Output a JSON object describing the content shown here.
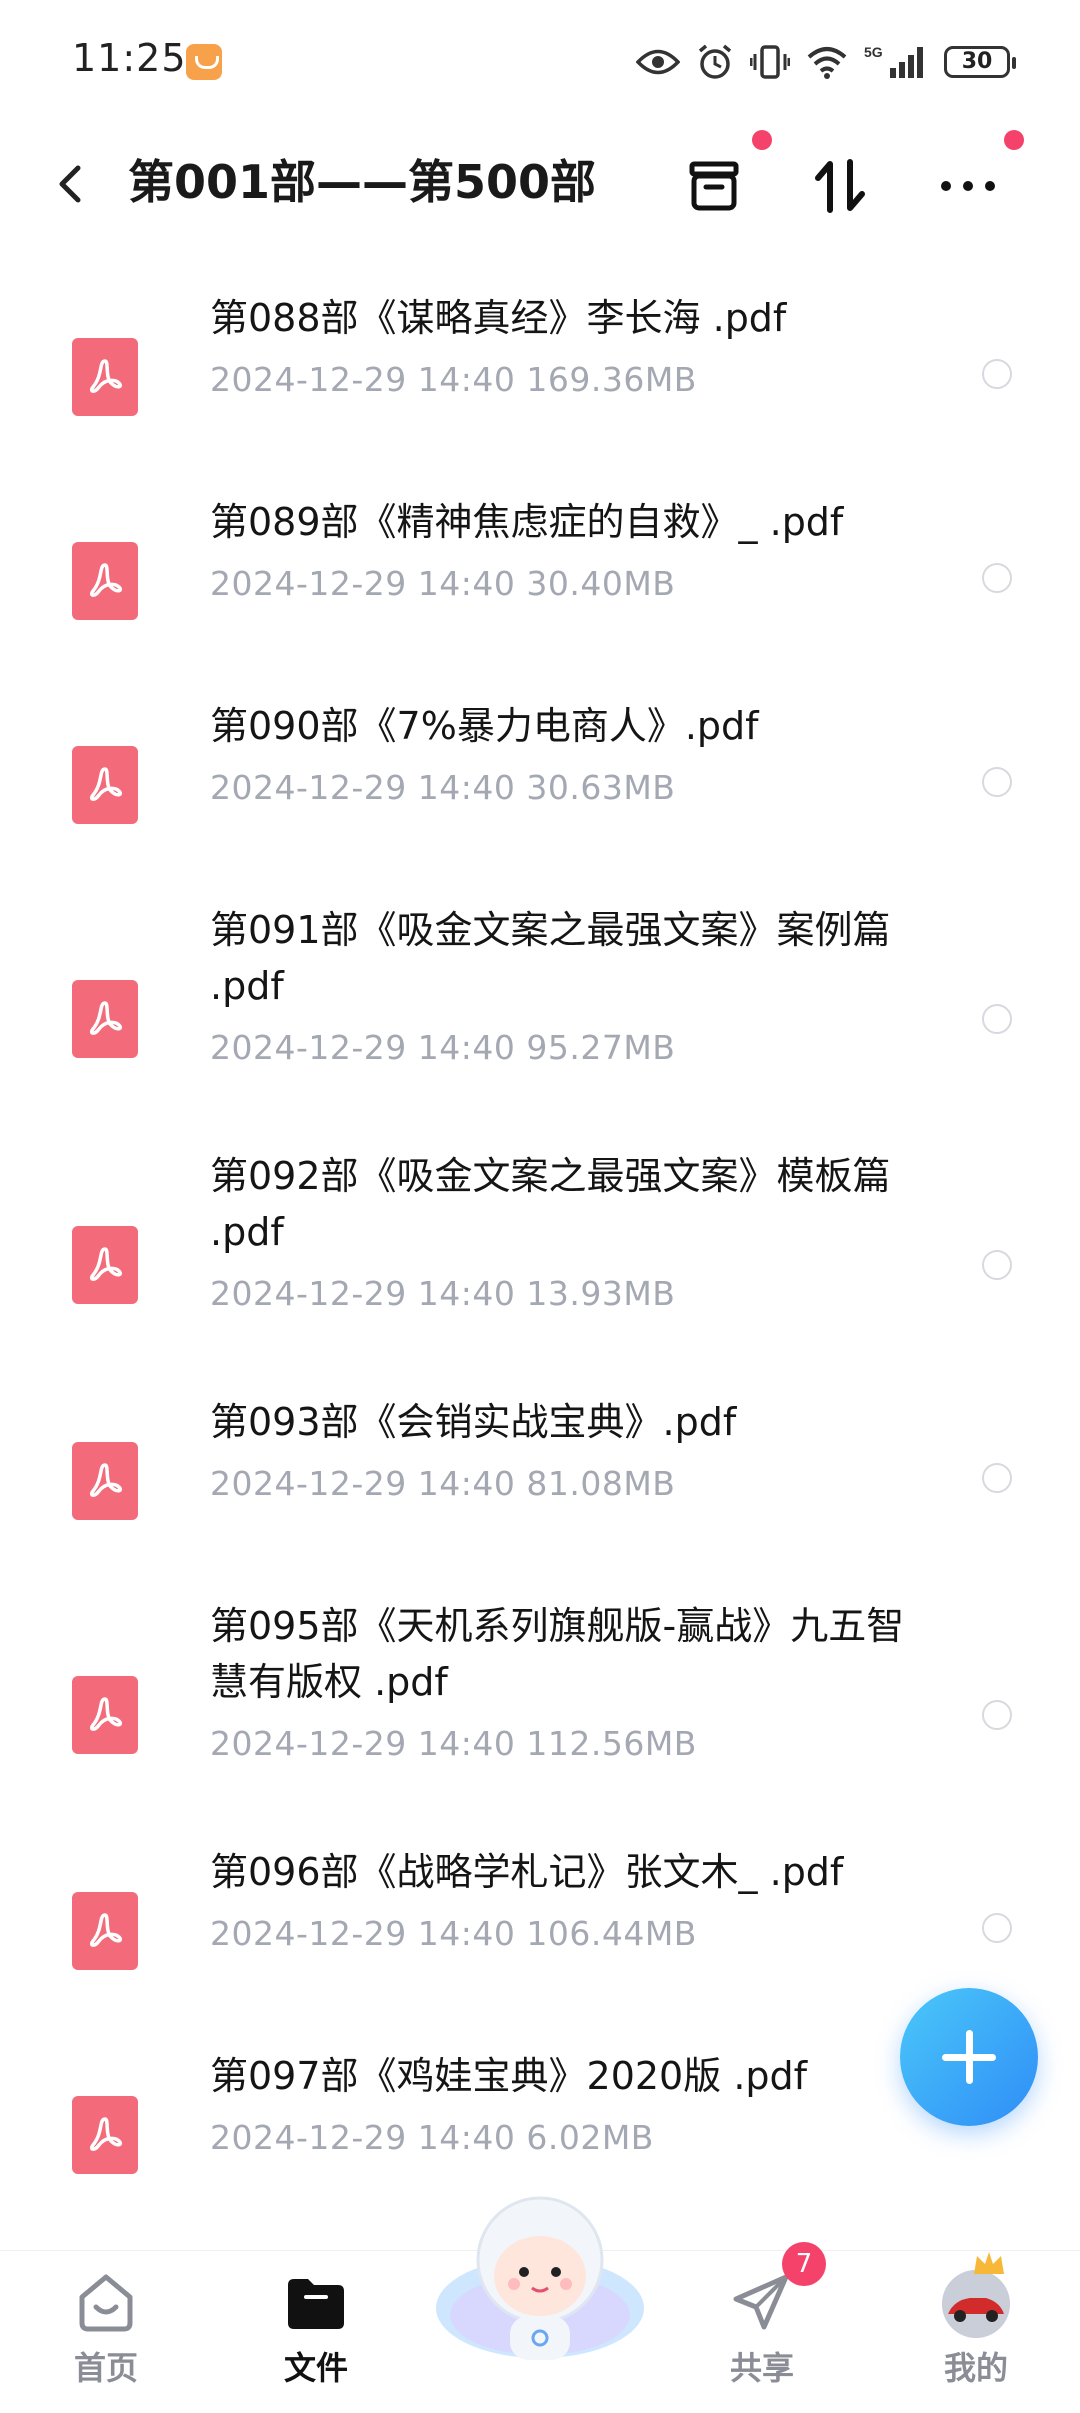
{
  "status_bar": {
    "time": "11:25",
    "battery": "30",
    "network": "5G"
  },
  "header": {
    "title": "第001部——第500部"
  },
  "files": [
    {
      "name": "第088部《谋略真经》李长海 .pdf",
      "meta": "2024-12-29  14:40  169.36MB"
    },
    {
      "name": "第089部《精神焦虑症的自救》_ .pdf",
      "meta": "2024-12-29  14:40  30.40MB"
    },
    {
      "name": "第090部《7%暴力电商人》.pdf",
      "meta": "2024-12-29  14:40  30.63MB"
    },
    {
      "name": "第091部《吸金文案之最强文案》案例篇 .pdf",
      "meta": "2024-12-29  14:40  95.27MB"
    },
    {
      "name": "第092部《吸金文案之最强文案》模板篇 .pdf",
      "meta": "2024-12-29  14:40  13.93MB"
    },
    {
      "name": "第093部《会销实战宝典》.pdf",
      "meta": "2024-12-29  14:40  81.08MB"
    },
    {
      "name": "第095部《天机系列旗舰版-赢战》九五智慧有版权 .pdf",
      "meta": "2024-12-29  14:40  112.56MB"
    },
    {
      "name": "第096部《战略学札记》张文木_ .pdf",
      "meta": "2024-12-29  14:40  106.44MB"
    },
    {
      "name": "第097部《鸡娃宝典》2020版 .pdf",
      "meta": "2024-12-29  14:40  6.02MB"
    }
  ],
  "bottom_nav": {
    "home": "首页",
    "files": "文件",
    "share": "共享",
    "share_badge": "7",
    "me": "我的"
  },
  "colors": {
    "accent": "#2f8df6",
    "pdf": "#f36b7a",
    "badge": "#f5426b",
    "meta": "#a4a8b2"
  }
}
